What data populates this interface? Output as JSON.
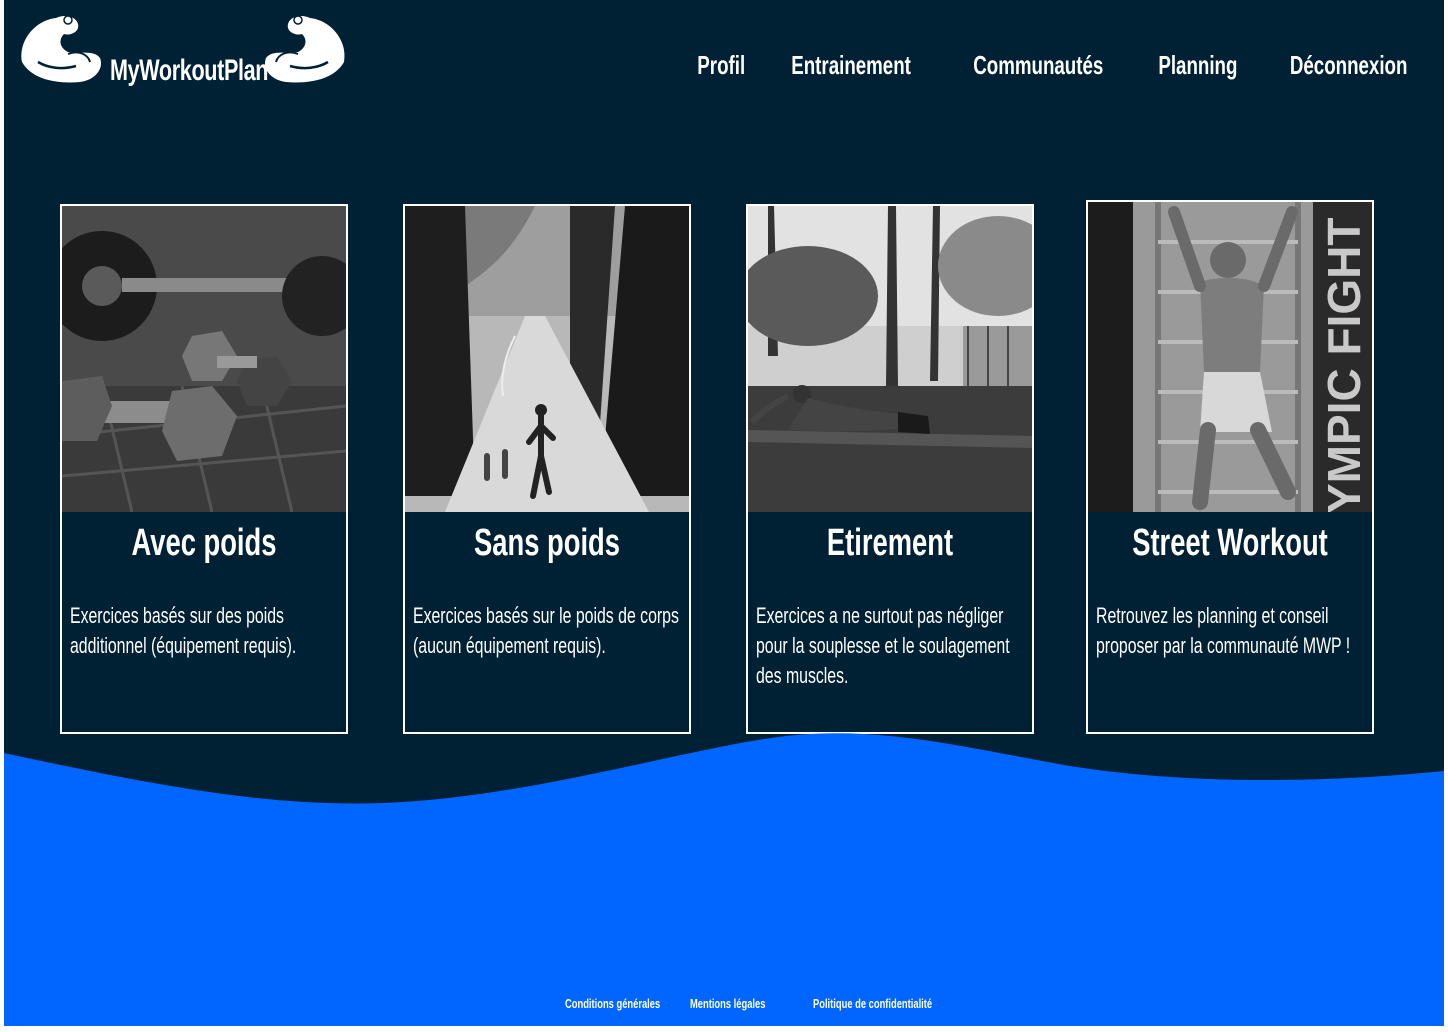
{
  "header": {
    "logo_text": "MyWorkoutPlan",
    "nav": [
      "Profil",
      "Entrainement",
      "Communautés",
      "Planning",
      "Déconnexion"
    ]
  },
  "cards": [
    {
      "title": "Avec poids",
      "description": "Exercices basés sur des poids additionnel (équipement requis).",
      "image_icon": "dumbbell-photo"
    },
    {
      "title": "Sans poids",
      "description": "Exercices basés sur le poids de corps (aucun équipement requis).",
      "image_icon": "runner-photo"
    },
    {
      "title": "Etirement",
      "description": "Exercices a ne surtout pas négliger pour la souplesse et le soulagement des muscles.",
      "image_icon": "stretch-photo"
    },
    {
      "title": "Street Workout",
      "description": "Retrouvez les planning et conseil proposer par la communauté MWP !",
      "image_icon": "pullup-photo",
      "image_text": "YMPIC FIGHT"
    }
  ],
  "footer": {
    "links": [
      "Conditions générales",
      "Mentions légales",
      "Politique de confidentialité"
    ]
  },
  "colors": {
    "background": "#002033",
    "wave": "#0066ff",
    "text": "#ffffff"
  }
}
